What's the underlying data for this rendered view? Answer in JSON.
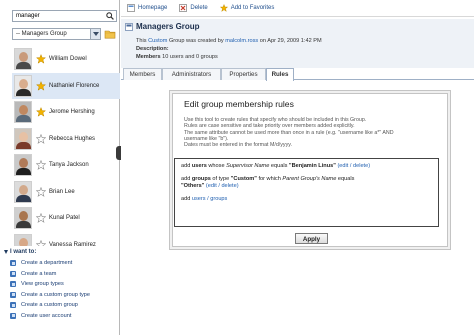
{
  "search": {
    "value": "manager"
  },
  "group_select": {
    "value": "-- Managers Group"
  },
  "people": [
    {
      "name": "William Dowel",
      "starred": true,
      "selected": false,
      "skin": "#c99a7a",
      "shirt": "#4a4a4a",
      "bg": "#d9d9d9"
    },
    {
      "name": "Nathaniel Florence",
      "starred": true,
      "selected": true,
      "skin": "#d9ad8e",
      "shirt": "#2a2a2a",
      "bg": "#e8e8e8"
    },
    {
      "name": "Jerome Hershing",
      "starred": true,
      "selected": false,
      "skin": "#c08860",
      "shirt": "#5a6a7a",
      "bg": "#b9b9b9"
    },
    {
      "name": "Rebecca Hughes",
      "starred": false,
      "selected": false,
      "skin": "#e7c1a4",
      "shirt": "#7a3a2a",
      "bg": "#d0c7bd"
    },
    {
      "name": "Tanya Jackson",
      "starred": false,
      "selected": false,
      "skin": "#b07a58",
      "shirt": "#1f1f1f",
      "bg": "#c9c9c9"
    },
    {
      "name": "Brian Lee",
      "starred": false,
      "selected": false,
      "skin": "#d2a98b",
      "shirt": "#2f3a4f",
      "bg": "#dcdcdc"
    },
    {
      "name": "Kunal Patel",
      "starred": false,
      "selected": false,
      "skin": "#a9764f",
      "shirt": "#3a3a3a",
      "bg": "#cfcfcf"
    },
    {
      "name": "Vanessa Ramirez",
      "starred": false,
      "selected": false,
      "skin": "#d7a888",
      "shirt": "#303030",
      "bg": "#d5d5d5"
    }
  ],
  "iwant": {
    "title": "I want to:",
    "actions": [
      "Create a department",
      "Create a team",
      "View group types",
      "Create a custom group type",
      "Create a custom group",
      "Create user account"
    ]
  },
  "toolbar": {
    "homepage": "Homepage",
    "delete": "Delete",
    "favorites": "Add to Favorites"
  },
  "header": {
    "title": "Managers Group",
    "line1_pre": "This ",
    "line1_link1": "Custom",
    "line1_mid": " Group was created by ",
    "line1_link2": "malcolm.ross",
    "line1_post": " on Apr 29, 2009 1:42 PM",
    "description_label": "Description:",
    "members_label": "Members",
    "members_value": "10 users and 0 groups"
  },
  "tabs": [
    "Members",
    "Administrators",
    "Properties",
    "Rules"
  ],
  "active_tab": "Rules",
  "rules": {
    "title": "Edit group membership rules",
    "info": [
      "Use this tool to create rules that specify who should be included in this Group.",
      "Rules are case sensitive and take priority over members added explicitly.",
      "The same attribute cannot be used more than once in a rule (e.g. \"username like a*\" AND",
      "username like \"b\").",
      "Dates must be entered in the format M/d/yyyy."
    ],
    "rule1": {
      "pre": "add ",
      "who": "users",
      "mid": " whose ",
      "attr": "Supervisor Name",
      "op": " equals ",
      "val": "\"Benjamin Linus\"",
      "links": "(edit / delete)"
    },
    "rule2": {
      "pre": "add ",
      "who": "groups",
      "mid": " of type ",
      "val1": "\"Custom\"",
      "mid2": " for which ",
      "attr": "Parent Group's Name",
      "op": " equals",
      "val2": "\"Others\"",
      "links": "(edit / delete)"
    },
    "rule3": {
      "pre": "add ",
      "links": "users / groups"
    },
    "apply_label": "Apply"
  },
  "colors": {
    "accent": "#1f5fb0",
    "star": "#f2b200",
    "selected_row": "#dce7f5"
  }
}
